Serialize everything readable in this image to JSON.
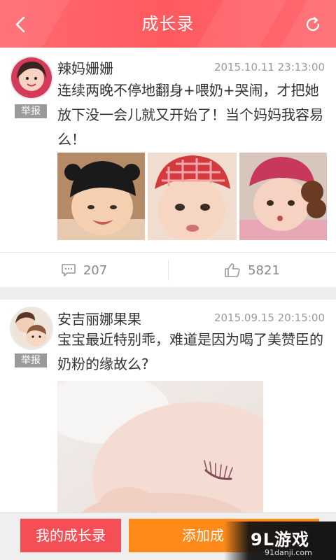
{
  "header": {
    "title": "成长录",
    "back_icon": "chevron-left-icon",
    "refresh_icon": "refresh-icon"
  },
  "posts": [
    {
      "author": "辣妈姗姗",
      "time": "2015.10.11 23:13:00",
      "report_label": "举报",
      "content": "连续两晚不停地翻身+喂奶+哭闹，才把她放下没一会儿就又开始了！当个妈妈我容易么！",
      "photos": [
        "baby-black-hat-photo",
        "baby-red-bandana-photo",
        "baby-pink-hat-photo"
      ],
      "comments": "207",
      "likes": "5821"
    },
    {
      "author": "安吉丽娜果果",
      "time": "2015.09.15 20:15:00",
      "report_label": "举报",
      "content": "宝宝最近特别乖，难道是因为喝了美赞臣的奶粉的缘故么?",
      "photos": [
        "sleeping-baby-photo"
      ]
    }
  ],
  "bottom": {
    "my_button": "我的成长录",
    "add_button": "添加成"
  },
  "watermark": {
    "main": "9L游戏",
    "sub": "91danji.com"
  },
  "colors": {
    "header": "#ff5a60",
    "my_button": "#f34f55",
    "add_button": "#ff8a1a",
    "report_badge": "#9a9a9a"
  }
}
